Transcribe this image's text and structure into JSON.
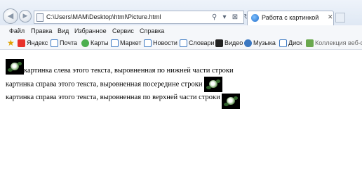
{
  "browser": {
    "address": "C:\\Users\\MAM\\Desktop\\html\\Picture.html",
    "address_tools": [
      "⚲",
      "▾",
      "⊠",
      "↻",
      "✕"
    ],
    "tab": {
      "title": "Работа с картинкой",
      "close": "✕"
    },
    "nav": {
      "back": "◀",
      "forward": "▶"
    }
  },
  "menu": {
    "items": [
      "Файл",
      "Правка",
      "Вид",
      "Избранное",
      "Сервис",
      "Справка"
    ]
  },
  "favorites": {
    "star": "★",
    "items": [
      {
        "label": "Яндекс",
        "icon": "yandex-icon",
        "color": "#e8322b"
      },
      {
        "label": "Почта",
        "icon": "page-icon",
        "color": "#3b78c2"
      },
      {
        "label": "Карты",
        "icon": "maps-icon",
        "color": "#4caf50"
      },
      {
        "label": "Маркет",
        "icon": "page-icon",
        "color": "#3b78c2"
      },
      {
        "label": "Новости",
        "icon": "page-icon",
        "color": "#3b78c2"
      },
      {
        "label": "Словари",
        "icon": "page-icon",
        "color": "#3b78c2"
      },
      {
        "label": "Видео",
        "icon": "video-icon",
        "color": "#222222"
      },
      {
        "label": "Музыка",
        "icon": "music-icon",
        "color": "#3b78c2"
      },
      {
        "label": "Диск",
        "icon": "page-icon",
        "color": "#3b78c2"
      },
      {
        "label": "Коллекция веб-фр",
        "icon": "gallery-icon",
        "color": "#6aa84f"
      }
    ]
  },
  "content": {
    "line1": "картинка слева этого текста, выровненная по нижней части строки",
    "line2": "картинка справа этого текста, выровненная посередине строки",
    "line3": "картинка справа этого текста, выровненная по верхней части строки"
  }
}
